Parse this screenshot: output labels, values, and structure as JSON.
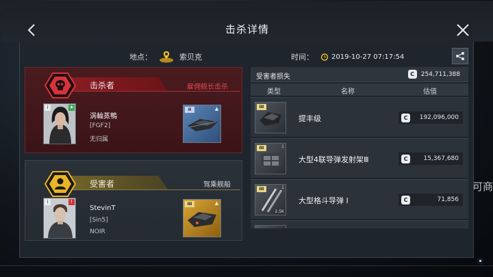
{
  "header": {
    "title": "击杀详情"
  },
  "info": {
    "location_label": "地点：",
    "location_value": "索贝克",
    "time_label": "时间：",
    "time_value": "2019-10-27 07:17:54"
  },
  "killer": {
    "section_label": "击杀者",
    "method": "雇佣舰长击杀",
    "pilot_name": "涡輪蒸鴨",
    "corp": "[FGF2]",
    "alliance": "无归属",
    "ship_tier": "II"
  },
  "victim": {
    "section_label": "受害者",
    "method": "驾乘舰船",
    "pilot_name": "StevinT",
    "corp": "[Sin5]",
    "alliance": "NOIR",
    "ship_tier": "III"
  },
  "loss": {
    "title": "受害者损失",
    "total_value": "254,711,388",
    "columns": [
      "类型",
      "名称",
      "估值"
    ],
    "items": [
      {
        "name": "提丰级",
        "value": "192,096,000",
        "tier": "III",
        "level": "",
        "qty": ""
      },
      {
        "name": "大型4联导弹发射架Ⅲ",
        "value": "15,367,680",
        "tier": "III",
        "level": "1",
        "qty": ""
      },
      {
        "name": "大型格斗导弹 I",
        "value": "71,856",
        "tier": "III",
        "level": "1",
        "qty": "2.5K"
      }
    ]
  },
  "background": {
    "side_text": "可商"
  },
  "colors": {
    "killer_red": "#8f1e24",
    "victim_gold": "#d9b43a",
    "panel_bg": "#1f252c"
  }
}
